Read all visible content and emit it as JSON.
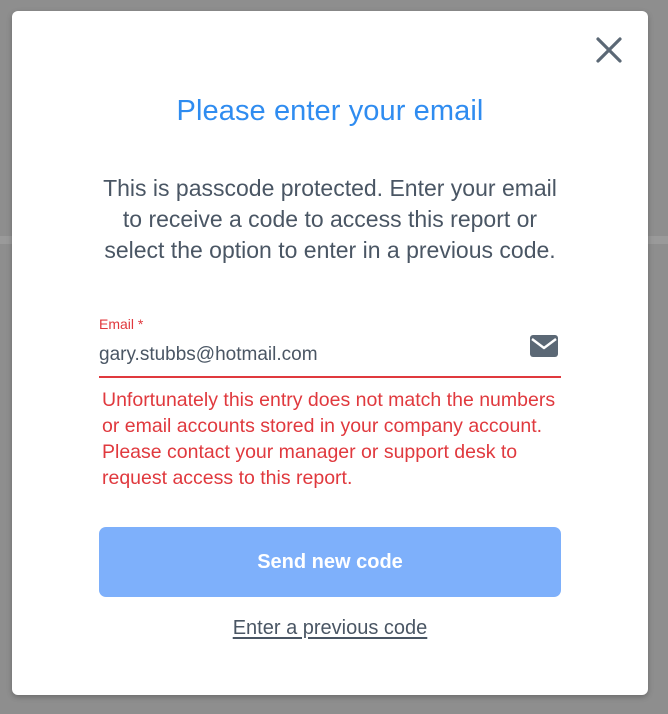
{
  "modal": {
    "title": "Please enter your email",
    "description": "This is passcode protected. Enter your email to receive a code to access this report or select the option to enter in a previous code.",
    "close_icon": "close-icon"
  },
  "email_field": {
    "label": "Email *",
    "value": "gary.stubbs@hotmail.com",
    "icon": "envelope-icon",
    "error": "Unfortunately this entry does not match the numbers or email accounts stored in your company account. Please contact your manager or support desk to request access to this report."
  },
  "actions": {
    "send_label": "Send new code",
    "previous_label": "Enter a previous code"
  },
  "colors": {
    "title": "#2f8cf0",
    "error": "#e0393e",
    "button": "#7eb0fb",
    "text": "#4a5664"
  }
}
